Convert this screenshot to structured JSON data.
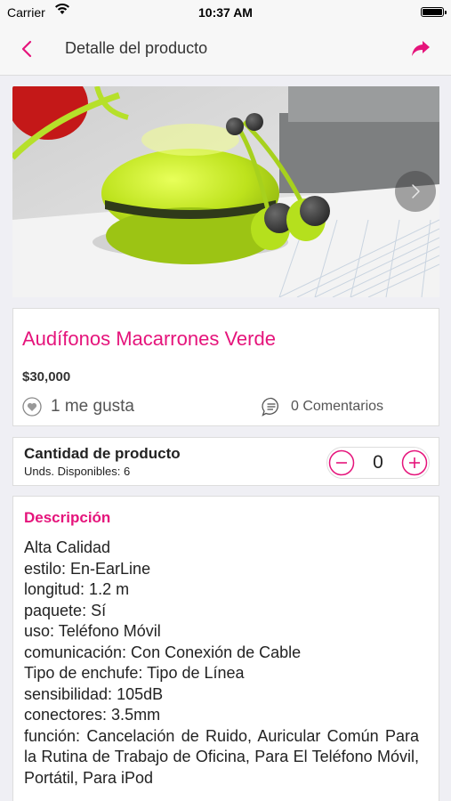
{
  "status_bar": {
    "carrier": "Carrier",
    "time": "10:37 AM",
    "wifi_icon": "wifi-icon",
    "battery_icon": "battery-icon"
  },
  "nav": {
    "title": "Detalle del producto",
    "back_icon": "chevron-left-icon",
    "share_icon": "share-icon",
    "accent_color": "#e5147b"
  },
  "gallery": {
    "image": "green macaron earphones case photo",
    "next_icon": "chevron-right-icon"
  },
  "product": {
    "name": "Audífonos Macarrones Verde",
    "price": "$30,000",
    "likes_label": "1 me gusta",
    "comments_label": "0 Comentarios"
  },
  "quantity": {
    "title": "Cantidad de producto",
    "available": "Unds. Disponibles: 6",
    "value": "0"
  },
  "description": {
    "title": "Descripción",
    "lines": [
      "Alta Calidad",
      "estilo: En-EarLine",
      "longitud: 1.2 m",
      "paquete: Sí",
      "uso: Teléfono Móvil",
      "comunicación: Con Conexión de Cable",
      "Tipo de enchufe: Tipo de Línea",
      "sensibilidad: 105dB",
      "conectores: 3.5mm",
      "función: Cancelación de Ruido, Auricular Común Para la Rutina de Trabajo de Oficina, Para El Teléfono Móvil, Portátil, Para iPod"
    ]
  }
}
